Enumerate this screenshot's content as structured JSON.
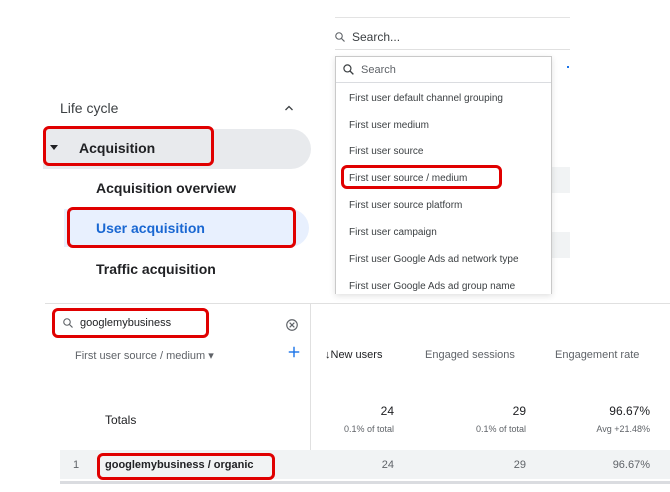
{
  "top_search": {
    "placeholder": "Search..."
  },
  "dropdown": {
    "search_placeholder": "Search",
    "items": [
      "First user default channel grouping",
      "First user medium",
      "First user source",
      "First user source / medium",
      "First user source platform",
      "First user campaign",
      "First user Google Ads ad network type",
      "First user Google Ads ad group name"
    ]
  },
  "sidebar": {
    "section": "Life cycle",
    "group": "Acquisition",
    "items": [
      "Acquisition overview",
      "User acquisition",
      "Traffic acquisition"
    ]
  },
  "table": {
    "filter_value": "googlemybusiness",
    "dimension_header": "First user source / medium ▾",
    "columns": [
      "↓New users",
      "Engaged sessions",
      "Engagement rate"
    ],
    "totals": {
      "label": "Totals",
      "new_users": "24",
      "new_users_sub": "0.1% of total",
      "engaged_sessions": "29",
      "engaged_sessions_sub": "0.1% of total",
      "engagement_rate": "96.67%",
      "engagement_rate_sub": "Avg +21.48%"
    },
    "rows": [
      {
        "index": "1",
        "name": "googlemybusiness / organic",
        "new_users": "24",
        "engaged_sessions": "29",
        "engagement_rate": "96.67%"
      }
    ]
  },
  "colors": {
    "highlight": "#e00000",
    "accent": "#1a73e8",
    "active_bg": "#e8f0fe",
    "hover_bg": "#e8eaed"
  }
}
